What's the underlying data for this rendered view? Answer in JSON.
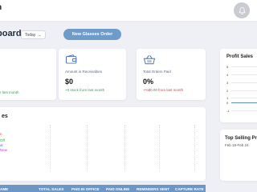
{
  "header": {
    "brand": "n",
    "notifications_icon": "bell-icon"
  },
  "toolbar": {
    "title": "board",
    "period": "Today",
    "new_order_label": "New Glasses Order"
  },
  "kpis": [
    {
      "label": "",
      "value": "",
      "delta": "r last month",
      "delta_color": "#3aa35b",
      "icon": ""
    },
    {
      "label": "Amount in Receivables",
      "value": "$0",
      "delta": "+0 stock from last month",
      "delta_color": "#3aa35b",
      "icon": "wallet-icon"
    },
    {
      "label": "Total Orders Paid",
      "value": "0%",
      "delta": "+%$0.00 from last month",
      "delta_color": "#d64a4a",
      "icon": "shopping-basket-icon"
    }
  ],
  "profit": {
    "title": "Profit Sales",
    "ticks": [
      "5",
      "4",
      "3",
      "2",
      "1",
      "0",
      "-1"
    ]
  },
  "sales": {
    "title": "es",
    "legend": [
      {
        "label": "n",
        "color": "#d64a4a"
      },
      {
        "label": "Off",
        "color": "#3aa35b"
      },
      {
        "label": "al",
        "color": "#4a74b8"
      },
      {
        "label": "New",
        "color": "#a64ad6"
      }
    ]
  },
  "top_selling": {
    "title": "Top Selling Pr",
    "range": "Feb 18-Feb 24"
  },
  "table": {
    "columns": [
      "AME",
      "TOTAL SALES",
      "PAID IN OFFICE",
      "PAID ONLINE",
      "REMINDERS SENT",
      "CAPTURE RATE"
    ]
  }
}
